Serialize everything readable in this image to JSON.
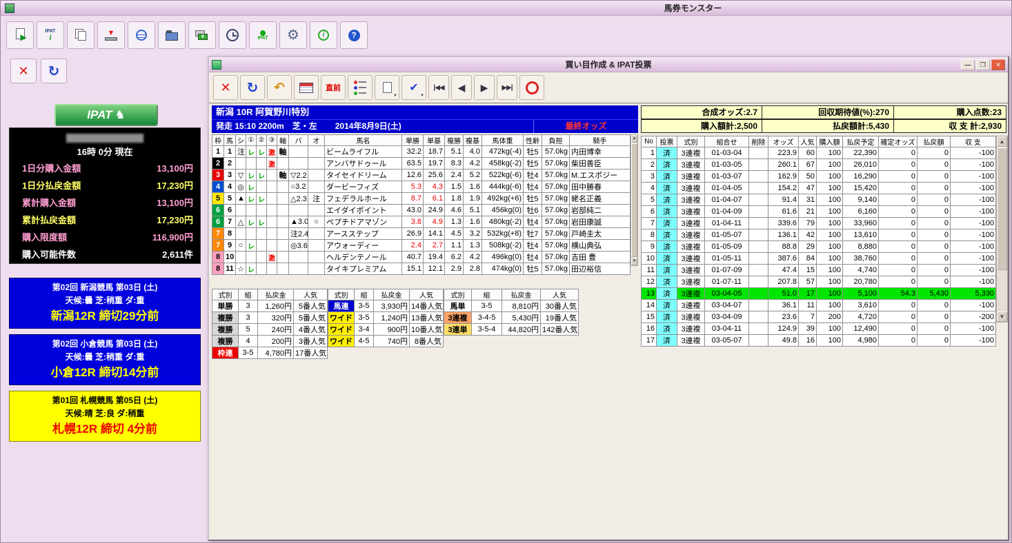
{
  "app": {
    "title": "馬券モンスター"
  },
  "icons": {
    "close_x": "✕",
    "refresh": "↻",
    "undo": "↶",
    "nav_first": "|◀◀",
    "nav_prev": "◀",
    "nav_next": "▶",
    "nav_last": "▶▶|",
    "dropdown": "▼",
    "info_i": "i",
    "help_q": "?",
    "gear": "⚙",
    "check": "✔",
    "minimize": "—",
    "maximize": "❐",
    "win_close": "✕",
    "up": "▲",
    "down": "▼",
    "arrow_right": "▶",
    "yen": "¥",
    "horse": "♞",
    "ipat_small": "IPAT"
  },
  "left_panel": {
    "ipat_logo": "IPAT",
    "account": {
      "time_line": "16時 0分 現在",
      "rows": [
        {
          "label": "1日分購入金額",
          "value": "13,100円",
          "color": "pink"
        },
        {
          "label": "1日分払戻金額",
          "value": "17,230円",
          "color": "yellow"
        },
        {
          "label": "累計購入金額",
          "value": "13,100円",
          "color": "pink"
        },
        {
          "label": "累計払戻金額",
          "value": "17,230円",
          "color": "yellow"
        },
        {
          "label": "購入限度額",
          "value": "116,900円",
          "color": "pink"
        },
        {
          "label": "購入可能件数",
          "value": "2,611件",
          "color": "white"
        }
      ]
    },
    "race_panels": [
      {
        "style": "blue",
        "line1": "第02回 新潟競馬 第03日 (土)",
        "line2": "天候:曇 芝:稍重 ダ:重",
        "line3": "新潟12R 締切29分前"
      },
      {
        "style": "blue",
        "line1": "第02回 小倉競馬 第03日 (土)",
        "line2": "天候:曇 芝:稍重 ダ:重",
        "line3": "小倉12R 締切14分前"
      },
      {
        "style": "yellow",
        "line1": "第01回 札幌競馬 第05日 (土)",
        "line2": "天候:晴 芝:良 ダ:稍重",
        "line3": "札幌12R 締切 4分前"
      }
    ]
  },
  "bet_window": {
    "title": "買い目作成 & IPAT投票",
    "toolbar": {
      "chokuzen": "直前"
    },
    "race_header": {
      "line1": "新潟 10R 阿賀野川特別",
      "start_info": "発走 15:10 2200m",
      "course": "芝・左",
      "date": "2014年8月9日(土)",
      "odds_status": "最終オッズ"
    },
    "horse_table": {
      "headers": [
        "枠",
        "馬",
        "シ",
        "①",
        "②",
        "③",
        "軸",
        "バ",
        "オ",
        "馬名",
        "単勝",
        "単基",
        "複勝",
        "複基",
        "馬体重",
        "性齢",
        "負担",
        "騎手"
      ],
      "rows": [
        {
          "waku": "1",
          "uma": "1",
          "m1": "注",
          "m2": "レ",
          "m3": "レ",
          "m4": "激",
          "m5": "軸",
          "m6": "",
          "m7": "",
          "name": "ビームライフル",
          "tan": "32.2",
          "tan_base": "18.7",
          "fuku": "5.1",
          "fuku_base": "4.0",
          "weight": "472kg(-4)",
          "sex_age": "牡5",
          "load": "57.0kg",
          "jockey": "内田博幸",
          "hot": false
        },
        {
          "waku": "2",
          "uma": "2",
          "m1": "",
          "m2": "",
          "m3": "",
          "m4": "激",
          "m5": "",
          "m6": "",
          "m7": "",
          "name": "アンバサドゥール",
          "tan": "63.5",
          "tan_base": "19.7",
          "fuku": "8.3",
          "fuku_base": "4.2",
          "weight": "458kg(-2)",
          "sex_age": "牡5",
          "load": "57.0kg",
          "jockey": "柴田善臣",
          "hot": false
        },
        {
          "waku": "3",
          "uma": "3",
          "m1": "▽",
          "m2": "レ",
          "m3": "レ",
          "m4": "",
          "m5": "軸",
          "m6": "▽2.2",
          "m7": "",
          "name": "タイセイドリーム",
          "tan": "12.6",
          "tan_base": "25.6",
          "fuku": "2.4",
          "fuku_base": "5.2",
          "weight": "522kg(-6)",
          "sex_age": "牡4",
          "load": "57.0kg",
          "jockey": "M.エスポジー",
          "hot": false
        },
        {
          "waku": "4",
          "uma": "4",
          "m1": "◎",
          "m2": "レ",
          "m3": "",
          "m4": "",
          "m5": "",
          "m6": "○3.2",
          "m7": "",
          "name": "ダービーフィズ",
          "tan": "5.3",
          "tan_base": "4.3",
          "fuku": "1.5",
          "fuku_base": "1.6",
          "weight": "444kg(-6)",
          "sex_age": "牡4",
          "load": "57.0kg",
          "jockey": "田中勝春",
          "hot": true
        },
        {
          "waku": "5",
          "uma": "5",
          "m1": "▲",
          "m2": "レ",
          "m3": "レ",
          "m4": "",
          "m5": "",
          "m6": "△2.3",
          "m7": "注",
          "name": "フェデラルホール",
          "tan": "8.7",
          "tan_base": "6.1",
          "fuku": "1.8",
          "fuku_base": "1.9",
          "weight": "492kg(+6)",
          "sex_age": "牡5",
          "load": "57.0kg",
          "jockey": "蛯名正義",
          "hot": true
        },
        {
          "waku": "6",
          "uma": "6",
          "m1": "",
          "m2": "",
          "m3": "",
          "m4": "",
          "m5": "",
          "m6": "",
          "m7": "",
          "name": "エイダイポイント",
          "tan": "43.0",
          "tan_base": "24.9",
          "fuku": "4.6",
          "fuku_base": "5.1",
          "weight": "456kg(0)",
          "sex_age": "牡6",
          "load": "57.0kg",
          "jockey": "岩部純二",
          "hot": false
        },
        {
          "waku": "6",
          "uma": "7",
          "m1": "△",
          "m2": "レ",
          "m3": "レ",
          "m4": "",
          "m5": "",
          "m6": "▲3.0",
          "m7": "○",
          "name": "ペプチドアマゾン",
          "tan": "3.8",
          "tan_base": "4.9",
          "fuku": "1.3",
          "fuku_base": "1.6",
          "weight": "480kg(-2)",
          "sex_age": "牡4",
          "load": "57.0kg",
          "jockey": "岩田康誠",
          "hot": true
        },
        {
          "waku": "7",
          "uma": "8",
          "m1": "",
          "m2": "",
          "m3": "",
          "m4": "",
          "m5": "",
          "m6": "注2.4",
          "m7": "",
          "name": "アースステップ",
          "tan": "26.9",
          "tan_base": "14.1",
          "fuku": "4.5",
          "fuku_base": "3.2",
          "weight": "532kg(+8)",
          "sex_age": "牡7",
          "load": "57.0kg",
          "jockey": "戸崎圭太",
          "hot": false
        },
        {
          "waku": "7",
          "uma": "9",
          "m1": "○",
          "m2": "レ",
          "m3": "",
          "m4": "",
          "m5": "",
          "m6": "◎3.6",
          "m7": "",
          "name": "アウォーディー",
          "tan": "2.4",
          "tan_base": "2.7",
          "fuku": "1.1",
          "fuku_base": "1.3",
          "weight": "508kg(-2)",
          "sex_age": "牡4",
          "load": "57.0kg",
          "jockey": "横山典弘",
          "hot": true
        },
        {
          "waku": "8",
          "uma": "10",
          "m1": "",
          "m2": "",
          "m3": "",
          "m4": "激",
          "m5": "",
          "m6": "",
          "m7": "",
          "name": "ヘルデンテノール",
          "tan": "40.7",
          "tan_base": "19.4",
          "fuku": "6.2",
          "fuku_base": "4.2",
          "weight": "496kg(0)",
          "sex_age": "牡4",
          "load": "57.0kg",
          "jockey": "吉田 豊",
          "hot": false
        },
        {
          "waku": "8",
          "uma": "11",
          "m1": "☆",
          "m2": "レ",
          "m3": "",
          "m4": "",
          "m5": "",
          "m6": "",
          "m7": "",
          "name": "タイキプレミアム",
          "tan": "15.1",
          "tan_base": "12.1",
          "fuku": "2.9",
          "fuku_base": "2.8",
          "weight": "474kg(0)",
          "sex_age": "牡5",
          "load": "57.0kg",
          "jockey": "田辺裕信",
          "hot": false
        }
      ]
    },
    "payout_tables": {
      "headers": [
        "式別",
        "組",
        "払戻金",
        "人気"
      ],
      "groups": [
        [
          {
            "type": "単勝",
            "kumi": "3",
            "payout": "1,260円",
            "ninki": "5番人気"
          },
          {
            "type": "複勝",
            "kumi": "3",
            "payout": "320円",
            "ninki": "5番人気"
          },
          {
            "type": "複勝",
            "kumi": "5",
            "payout": "240円",
            "ninki": "4番人気"
          },
          {
            "type": "複勝",
            "kumi": "4",
            "payout": "200円",
            "ninki": "3番人気"
          },
          {
            "type": "枠連",
            "kumi": "3-5",
            "payout": "4,780円",
            "ninki": "17番人気"
          }
        ],
        [
          {
            "type": "馬連",
            "kumi": "3-5",
            "payout": "3,930円",
            "ninki": "14番人気"
          },
          {
            "type": "ワイド",
            "kumi": "3-5",
            "payout": "1,240円",
            "ninki": "13番人気"
          },
          {
            "type": "ワイド",
            "kumi": "3-4",
            "payout": "900円",
            "ninki": "10番人気"
          },
          {
            "type": "ワイド",
            "kumi": "4-5",
            "payout": "740円",
            "ninki": "8番人気"
          }
        ],
        [
          {
            "type": "馬単",
            "kumi": "3-5",
            "payout": "8,810円",
            "ninki": "30番人気"
          },
          {
            "type": "3連複",
            "kumi": "3-4-5",
            "payout": "5,430円",
            "ninki": "19番人気"
          },
          {
            "type": "3連単",
            "kumi": "3-5-4",
            "payout": "44,820円",
            "ninki": "142番人気"
          }
        ]
      ]
    },
    "summary": {
      "row1": [
        {
          "label": "合成オッズ:",
          "value": "2.7"
        },
        {
          "label": "回収期待値(%):",
          "value": "270"
        },
        {
          "label": "購入点数:",
          "value": "23"
        }
      ],
      "row2": [
        {
          "label": "購入額計:",
          "value": "2,500"
        },
        {
          "label": "払戻額計:",
          "value": "5,430"
        },
        {
          "label": "収 支 計:",
          "value": "2,930"
        }
      ]
    },
    "bet_table": {
      "headers": [
        "No",
        "投票",
        "式別",
        "組合せ",
        "削除",
        "オッズ",
        "人気",
        "購入額",
        "払戻予定",
        "確定オッズ",
        "払戻額",
        "収 支"
      ],
      "rows": [
        {
          "no": "1",
          "vote": "済",
          "type": "3連複",
          "kumi": "01-03-04",
          "odds": "223.9",
          "ninki": "60",
          "amount": "100",
          "expected": "22,390",
          "fixed_odds": "0",
          "payout": "0",
          "balance": "-100",
          "highlight": false
        },
        {
          "no": "2",
          "vote": "済",
          "type": "3連複",
          "kumi": "01-03-05",
          "odds": "260.1",
          "ninki": "67",
          "amount": "100",
          "expected": "26,010",
          "fixed_odds": "0",
          "payout": "0",
          "balance": "-100",
          "highlight": false
        },
        {
          "no": "3",
          "vote": "済",
          "type": "3連複",
          "kumi": "01-03-07",
          "odds": "162.9",
          "ninki": "50",
          "amount": "100",
          "expected": "16,290",
          "fixed_odds": "0",
          "payout": "0",
          "balance": "-100",
          "highlight": false
        },
        {
          "no": "4",
          "vote": "済",
          "type": "3連複",
          "kumi": "01-04-05",
          "odds": "154.2",
          "ninki": "47",
          "amount": "100",
          "expected": "15,420",
          "fixed_odds": "0",
          "payout": "0",
          "balance": "-100",
          "highlight": false
        },
        {
          "no": "5",
          "vote": "済",
          "type": "3連複",
          "kumi": "01-04-07",
          "odds": "91.4",
          "ninki": "31",
          "amount": "100",
          "expected": "9,140",
          "fixed_odds": "0",
          "payout": "0",
          "balance": "-100",
          "highlight": false
        },
        {
          "no": "6",
          "vote": "済",
          "type": "3連複",
          "kumi": "01-04-09",
          "odds": "61.6",
          "ninki": "21",
          "amount": "100",
          "expected": "6,160",
          "fixed_odds": "0",
          "payout": "0",
          "balance": "-100",
          "highlight": false
        },
        {
          "no": "7",
          "vote": "済",
          "type": "3連複",
          "kumi": "01-04-11",
          "odds": "339.6",
          "ninki": "79",
          "amount": "100",
          "expected": "33,960",
          "fixed_odds": "0",
          "payout": "0",
          "balance": "-100",
          "highlight": false
        },
        {
          "no": "8",
          "vote": "済",
          "type": "3連複",
          "kumi": "01-05-07",
          "odds": "136.1",
          "ninki": "42",
          "amount": "100",
          "expected": "13,610",
          "fixed_odds": "0",
          "payout": "0",
          "balance": "-100",
          "highlight": false
        },
        {
          "no": "9",
          "vote": "済",
          "type": "3連複",
          "kumi": "01-05-09",
          "odds": "88.8",
          "ninki": "29",
          "amount": "100",
          "expected": "8,880",
          "fixed_odds": "0",
          "payout": "0",
          "balance": "-100",
          "highlight": false
        },
        {
          "no": "10",
          "vote": "済",
          "type": "3連複",
          "kumi": "01-05-11",
          "odds": "387.6",
          "ninki": "84",
          "amount": "100",
          "expected": "38,760",
          "fixed_odds": "0",
          "payout": "0",
          "balance": "-100",
          "highlight": false
        },
        {
          "no": "11",
          "vote": "済",
          "type": "3連複",
          "kumi": "01-07-09",
          "odds": "47.4",
          "ninki": "15",
          "amount": "100",
          "expected": "4,740",
          "fixed_odds": "0",
          "payout": "0",
          "balance": "-100",
          "highlight": false
        },
        {
          "no": "12",
          "vote": "済",
          "type": "3連複",
          "kumi": "01-07-11",
          "odds": "207.8",
          "ninki": "57",
          "amount": "100",
          "expected": "20,780",
          "fixed_odds": "0",
          "payout": "0",
          "balance": "-100",
          "highlight": false
        },
        {
          "no": "13",
          "vote": "済",
          "type": "3連複",
          "kumi": "03-04-05",
          "odds": "51.0",
          "ninki": "17",
          "amount": "100",
          "expected": "5,100",
          "fixed_odds": "54.3",
          "payout": "5,430",
          "balance": "5,330",
          "highlight": true
        },
        {
          "no": "14",
          "vote": "済",
          "type": "3連複",
          "kumi": "03-04-07",
          "odds": "36.1",
          "ninki": "11",
          "amount": "100",
          "expected": "3,610",
          "fixed_odds": "0",
          "payout": "0",
          "balance": "-100",
          "highlight": false
        },
        {
          "no": "15",
          "vote": "済",
          "type": "3連複",
          "kumi": "03-04-09",
          "odds": "23.6",
          "ninki": "7",
          "amount": "200",
          "expected": "4,720",
          "fixed_odds": "0",
          "payout": "0",
          "balance": "-200",
          "highlight": false
        },
        {
          "no": "16",
          "vote": "済",
          "type": "3連複",
          "kumi": "03-04-11",
          "odds": "124.9",
          "ninki": "39",
          "amount": "100",
          "expected": "12,490",
          "fixed_odds": "0",
          "payout": "0",
          "balance": "-100",
          "highlight": false
        },
        {
          "no": "17",
          "vote": "済",
          "type": "3連複",
          "kumi": "03-05-07",
          "odds": "49.8",
          "ninki": "16",
          "amount": "100",
          "expected": "4,980",
          "fixed_odds": "0",
          "payout": "0",
          "balance": "-100",
          "highlight": false
        }
      ]
    }
  },
  "colors": {
    "waku": {
      "1": {
        "bg": "#ffffff",
        "fg": "#000000"
      },
      "2": {
        "bg": "#000000",
        "fg": "#ffffff"
      },
      "3": {
        "bg": "#e60000",
        "fg": "#ffffff"
      },
      "4": {
        "bg": "#0050d0",
        "fg": "#ffffff"
      },
      "5": {
        "bg": "#ffe800",
        "fg": "#000000"
      },
      "6": {
        "bg": "#00a040",
        "fg": "#ffffff"
      },
      "7": {
        "bg": "#ff8800",
        "fg": "#ffffff"
      },
      "8": {
        "bg": "#ff9ec0",
        "fg": "#000000"
      }
    },
    "bet_types": {
      "単勝": {
        "bg": "#ffffff",
        "fg": "#000000"
      },
      "複勝": {
        "bg": "#d8d8d8",
        "fg": "#000000"
      },
      "枠連": {
        "bg": "#ee0000",
        "fg": "#ffffff"
      },
      "馬連": {
        "bg": "#0000cc",
        "fg": "#ffffff"
      },
      "ワイド": {
        "bg": "#ffee00",
        "fg": "#000000"
      },
      "馬単": {
        "bg": "#ffffff",
        "fg": "#000000"
      },
      "3連複": {
        "bg": "#ffa366",
        "fg": "#000000"
      },
      "3連単": {
        "bg": "#ffdd66",
        "fg": "#000000"
      }
    },
    "highlight_row": "#00e600",
    "vote_cell": "#7dffff"
  }
}
